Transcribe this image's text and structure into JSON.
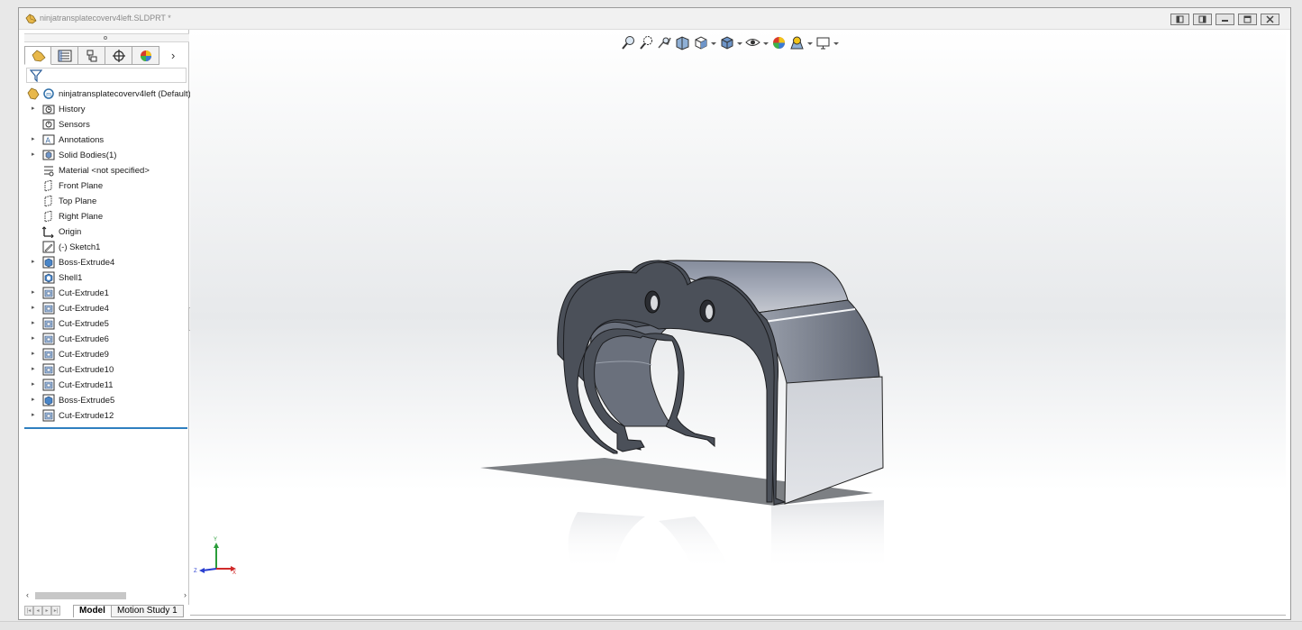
{
  "window": {
    "title": "ninjatransplatecoverv4left.SLDPRT *",
    "buttons": [
      "restore-left",
      "restore-right",
      "minimize",
      "maximize",
      "close"
    ]
  },
  "feature_manager": {
    "tabs": [
      "featuremanager-tab",
      "propertymanager-tab",
      "configurationmanager-tab",
      "dimxpert-tab",
      "display-manager-tab"
    ],
    "root_label": "ninjatransplatecoverv4left  (Default)",
    "items": [
      {
        "label": "History",
        "icon": "history-folder-icon",
        "expandable": true
      },
      {
        "label": "Sensors",
        "icon": "sensors-icon",
        "expandable": false
      },
      {
        "label": "Annotations",
        "icon": "annotations-icon",
        "expandable": true
      },
      {
        "label": "Solid Bodies(1)",
        "icon": "solid-bodies-icon",
        "expandable": true
      },
      {
        "label": "Material <not specified>",
        "icon": "material-icon",
        "expandable": false
      },
      {
        "label": "Front Plane",
        "icon": "plane-icon",
        "expandable": false
      },
      {
        "label": "Top Plane",
        "icon": "plane-icon",
        "expandable": false
      },
      {
        "label": "Right Plane",
        "icon": "plane-icon",
        "expandable": false
      },
      {
        "label": "Origin",
        "icon": "origin-icon",
        "expandable": false
      },
      {
        "label": "(-) Sketch1",
        "icon": "sketch-icon",
        "expandable": false
      },
      {
        "label": "Boss-Extrude4",
        "icon": "boss-extrude-icon",
        "expandable": true
      },
      {
        "label": "Shell1",
        "icon": "shell-icon",
        "expandable": false
      },
      {
        "label": "Cut-Extrude1",
        "icon": "cut-extrude-icon",
        "expandable": true
      },
      {
        "label": "Cut-Extrude4",
        "icon": "cut-extrude-icon",
        "expandable": true
      },
      {
        "label": "Cut-Extrude5",
        "icon": "cut-extrude-icon",
        "expandable": true
      },
      {
        "label": "Cut-Extrude6",
        "icon": "cut-extrude-icon",
        "expandable": true
      },
      {
        "label": "Cut-Extrude9",
        "icon": "cut-extrude-icon",
        "expandable": true
      },
      {
        "label": "Cut-Extrude10",
        "icon": "cut-extrude-icon",
        "expandable": true
      },
      {
        "label": "Cut-Extrude11",
        "icon": "cut-extrude-icon",
        "expandable": true
      },
      {
        "label": "Boss-Extrude5",
        "icon": "boss-extrude-icon",
        "expandable": true
      },
      {
        "label": "Cut-Extrude12",
        "icon": "cut-extrude-icon",
        "expandable": true
      }
    ]
  },
  "heads_up_toolbar": [
    "zoom-to-fit-icon",
    "zoom-to-area-icon",
    "previous-view-icon",
    "section-view-icon",
    "view-orientation-icon",
    "display-style-icon",
    "hide-show-items-icon",
    "edit-appearance-icon",
    "apply-scene-icon",
    "view-settings-icon"
  ],
  "triad": {
    "x": "X",
    "y": "Y",
    "z": "Z"
  },
  "bottom_tabs": {
    "model": "Model",
    "motion_study": "Motion Study 1"
  },
  "colors": {
    "accent": "#2f7fc0",
    "part_dark": "#4a4f58",
    "part_face": "#8a90a0"
  }
}
